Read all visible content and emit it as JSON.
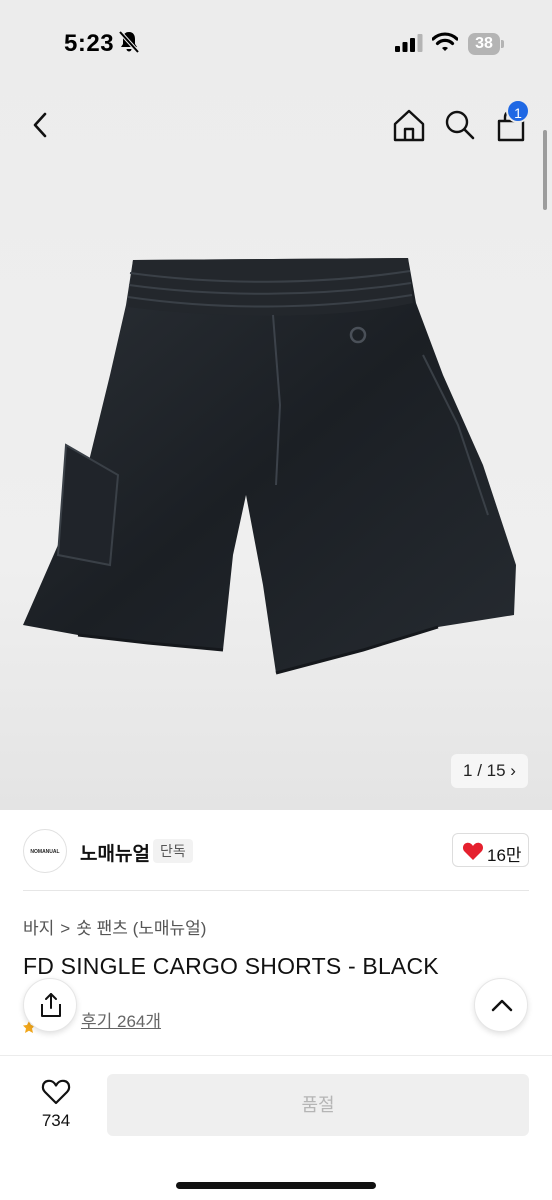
{
  "status_bar": {
    "time": "5:23",
    "battery": "38",
    "icons": [
      "bell-slash-icon",
      "signal-icon",
      "wifi-icon",
      "battery-icon"
    ]
  },
  "nav": {
    "cart_badge": "1",
    "icons": [
      "chevron-left-icon",
      "home-icon",
      "search-icon",
      "shopping-bag-icon"
    ],
    "badge_color": "#1f68e4"
  },
  "gallery": {
    "counter": "1 / 15",
    "image_name": "product-photo-black-cargo-shorts"
  },
  "brand": {
    "name": "노매뉴얼",
    "badge": "단독",
    "logo_text": "NOMANUAL",
    "likes": "16만",
    "heart_color": "#e5202e"
  },
  "breadcrumb": {
    "items": [
      "바지",
      "숏 팬츠 (노매뉴얼)"
    ],
    "separator": ">"
  },
  "product": {
    "title": "FD SINGLE CARGO SHORTS - BLACK",
    "reviews": "후기 264개"
  },
  "bottom_bar": {
    "wishlist_count": "734",
    "buy_button": "품절"
  }
}
